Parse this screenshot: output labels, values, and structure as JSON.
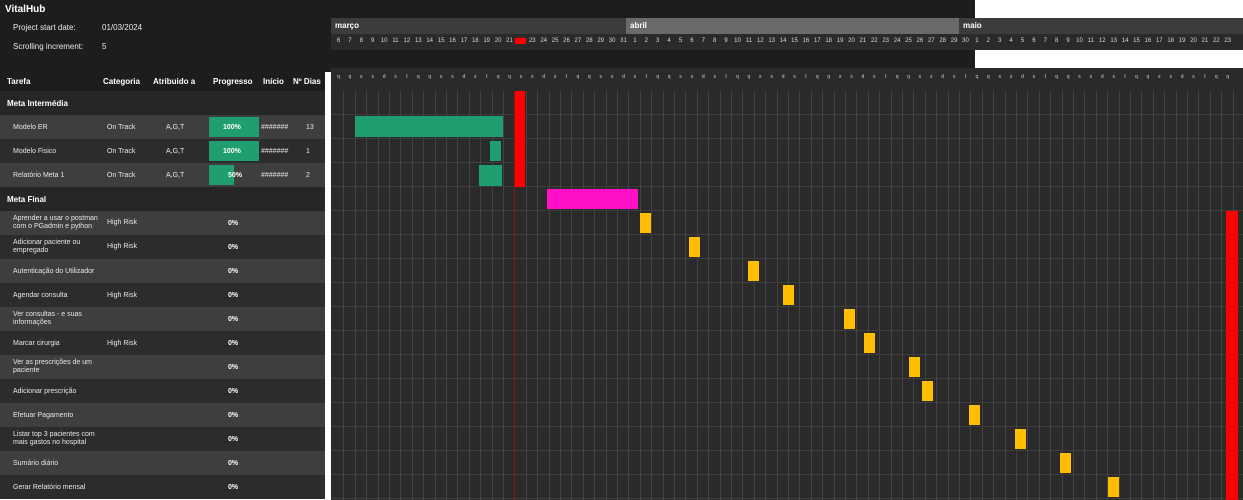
{
  "app": {
    "title": "VitalHub"
  },
  "project": {
    "start_label": "Project start date:",
    "start_value": "01/03/2024",
    "scroll_label": "Scrolling increment:",
    "scroll_value": "5"
  },
  "columns": {
    "task": "Tarefa",
    "category": "Categoria",
    "assigned": "Atribuido a",
    "progress": "Progresso",
    "start": "Início",
    "days": "Nº Dias"
  },
  "sections": [
    {
      "label": "Meta Intermédia",
      "tasks": [
        {
          "name": "Modelo ER",
          "category": "On Track",
          "assigned": "A,G,T",
          "progress_pct": 100,
          "progress_label": "100%",
          "start": "#######",
          "days": "13"
        },
        {
          "name": "Modelo Fisico",
          "category": "On Track",
          "assigned": "A,G,T",
          "progress_pct": 100,
          "progress_label": "100%",
          "start": "#######",
          "days": "1"
        },
        {
          "name": "Relatório Meta 1",
          "category": "On Track",
          "assigned": "A,G,T",
          "progress_pct": 50,
          "progress_label": "50%",
          "start": "#######",
          "days": "2"
        }
      ]
    },
    {
      "label": "Meta Final",
      "tasks": [
        {
          "name": "Aprender a usar o postman com o PGadmin e python",
          "category": "High Risk",
          "progress_pct": 0,
          "progress_label": "0%"
        },
        {
          "name": "Adicionar paciente ou empregado",
          "category": "High Risk",
          "progress_pct": 0,
          "progress_label": "0%"
        },
        {
          "name": "Autenticação do Utilizador",
          "category": "",
          "progress_pct": 0,
          "progress_label": "0%"
        },
        {
          "name": "Agendar consulta",
          "category": "High Risk",
          "progress_pct": 0,
          "progress_label": "0%"
        },
        {
          "name": "Ver consultas - e suas informações",
          "category": "",
          "progress_pct": 0,
          "progress_label": "0%"
        },
        {
          "name": "Marcar cirurgia",
          "category": "High Risk",
          "progress_pct": 0,
          "progress_label": "0%"
        },
        {
          "name": "Ver as prescrições de um paciente",
          "category": "",
          "progress_pct": 0,
          "progress_label": "0%"
        },
        {
          "name": "Adicionar prescrição",
          "category": "",
          "progress_pct": 0,
          "progress_label": "0%"
        },
        {
          "name": "Efetuar Pagamento",
          "category": "",
          "progress_pct": 0,
          "progress_label": "0%"
        },
        {
          "name": "Listar top 3 pacientes com mais gastos no hospital",
          "category": "",
          "progress_pct": 0,
          "progress_label": "0%"
        },
        {
          "name": "Sumário diário",
          "category": "",
          "progress_pct": 0,
          "progress_label": "0%"
        },
        {
          "name": "Gerar Relatório mensal",
          "category": "",
          "progress_pct": 0,
          "progress_label": "0%"
        }
      ]
    }
  ],
  "timeline": {
    "months": [
      "março",
      "abril",
      "maio"
    ],
    "day_numbers": [
      "6",
      "7",
      "8",
      "9",
      "10",
      "11",
      "12",
      "13",
      "14",
      "15",
      "16",
      "17",
      "18",
      "19",
      "20",
      "21",
      "22",
      "23",
      "24",
      "25",
      "26",
      "27",
      "28",
      "29",
      "30",
      "31",
      "1",
      "2",
      "3",
      "4",
      "5",
      "6",
      "7",
      "8",
      "9",
      "10",
      "11",
      "12",
      "13",
      "14",
      "15",
      "16",
      "17",
      "18",
      "19",
      "20",
      "21",
      "22",
      "23",
      "24",
      "25",
      "26",
      "27",
      "28",
      "29",
      "30",
      "1",
      "2",
      "3",
      "4",
      "5",
      "6",
      "7",
      "8",
      "9",
      "10",
      "11",
      "12",
      "13",
      "14",
      "15",
      "16",
      "17",
      "18",
      "19",
      "20",
      "21",
      "22",
      "23"
    ],
    "day_letters": [
      "q",
      "q",
      "s",
      "s",
      "d",
      "s",
      "t",
      "q",
      "q",
      "s",
      "s",
      "d",
      "s",
      "t",
      "q",
      "q",
      "s",
      "s",
      "d",
      "s",
      "t",
      "q",
      "q",
      "s",
      "s",
      "d",
      "s",
      "t",
      "q",
      "q",
      "s",
      "s",
      "d",
      "s",
      "t",
      "q",
      "q",
      "s",
      "s",
      "d",
      "s",
      "t",
      "q",
      "q",
      "s",
      "s",
      "d",
      "s",
      "t",
      "q",
      "q",
      "s",
      "s",
      "d",
      "s",
      "t",
      "q",
      "q",
      "s",
      "s",
      "d",
      "s",
      "t",
      "q",
      "q",
      "s",
      "s",
      "d",
      "s",
      "t",
      "q",
      "q",
      "s",
      "s",
      "d",
      "s",
      "t",
      "q",
      "q"
    ],
    "today_index": 16,
    "colors": {
      "done": "#1f9e6f",
      "milestone": "#ff10c8",
      "pending": "#ffbf00",
      "today": "#ff0000"
    }
  }
}
